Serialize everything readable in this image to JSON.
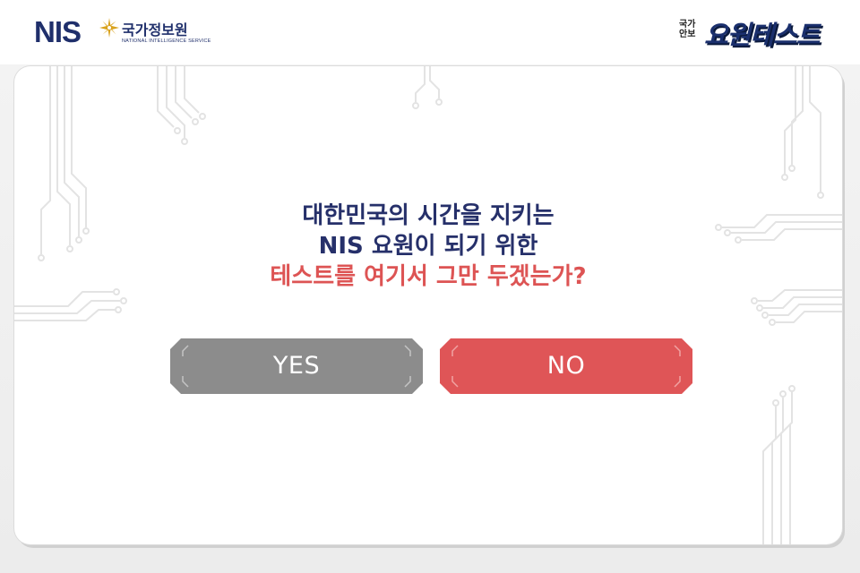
{
  "header": {
    "nis_logo": {
      "letters": "NIS",
      "korean": "국가정보원",
      "english": "NATIONAL INTELLIGENCE SERVICE",
      "star_icon": "star-burst-icon",
      "brand_color": "#1f2f6b",
      "star_color": "#d9a21c"
    },
    "test_logo": {
      "small_line1": "국가",
      "small_line2": "안보",
      "big": "요원테스트"
    }
  },
  "question": {
    "line1": "대한민국의 시간을 지키는",
    "line2": "NIS 요원이 되기 위한",
    "line3": "테스트를 여기서 그만 두겠는가?",
    "dark_color": "#26306a",
    "red_color": "#dd5454"
  },
  "buttons": {
    "yes": {
      "label": "YES",
      "color": "#8c8c8c"
    },
    "no": {
      "label": "NO",
      "color": "#df5557"
    }
  }
}
